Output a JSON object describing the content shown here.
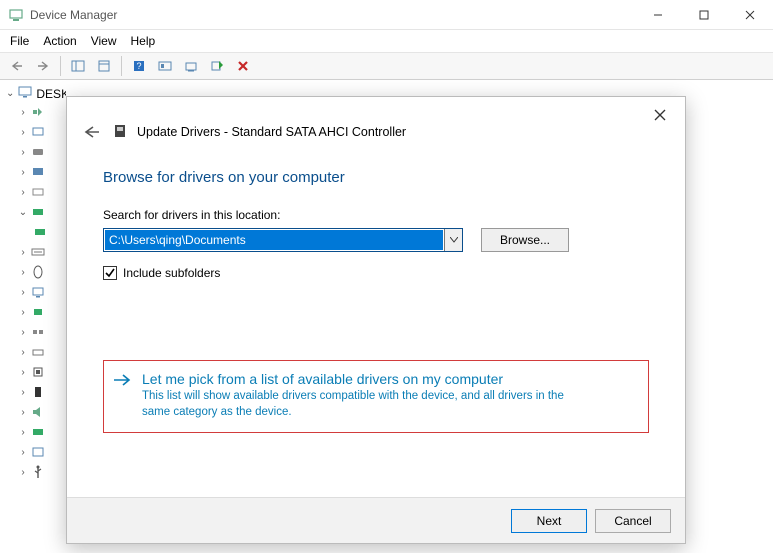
{
  "window": {
    "title": "Device Manager",
    "menu": {
      "file": "File",
      "action": "Action",
      "view": "View",
      "help": "Help"
    }
  },
  "tree": {
    "root": "DESKTOP-LDIDKBU"
  },
  "dialog": {
    "title": "Update Drivers - Standard SATA AHCI Controller",
    "heading": "Browse for drivers on your computer",
    "search_label": "Search for drivers in this location:",
    "path_value": "C:\\Users\\qing\\Documents",
    "browse_label": "Browse...",
    "include_subfolders": "Include subfolders",
    "pick_title": "Let me pick from a list of available drivers on my computer",
    "pick_desc": "This list will show available drivers compatible with the device, and all drivers in the same category as the device.",
    "next_label": "Next",
    "cancel_label": "Cancel"
  }
}
